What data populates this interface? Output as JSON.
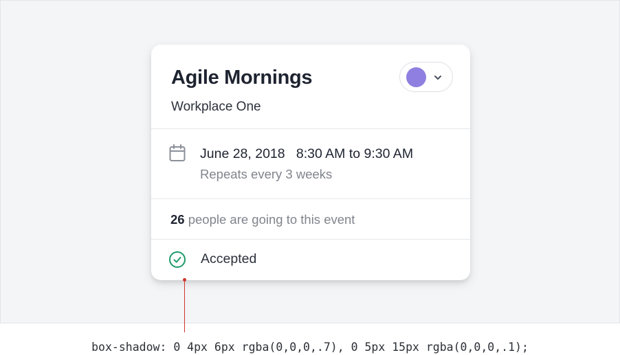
{
  "event": {
    "title": "Agile Mornings",
    "workplace": "Workplace One",
    "color": "#8f7fe0",
    "date": "June 28, 2018",
    "time": "8:30 AM to 9:30 AM",
    "repeat": "Repeats every 3 weeks",
    "attendee_count": "26",
    "attendee_text": " people are going to this event",
    "status": "Accepted"
  },
  "icons": {
    "color_picker_chevron": "chevron-down-icon",
    "date": "calendar-icon",
    "status": "check-circle-icon"
  },
  "colors": {
    "status_green": "#1f9a6b",
    "pointer_red": "#d0342c"
  },
  "annotation": {
    "caption": "box-shadow: 0 4px 6px rgba(0,0,0,.7), 0 5px 15px rgba(0,0,0,.1);"
  }
}
